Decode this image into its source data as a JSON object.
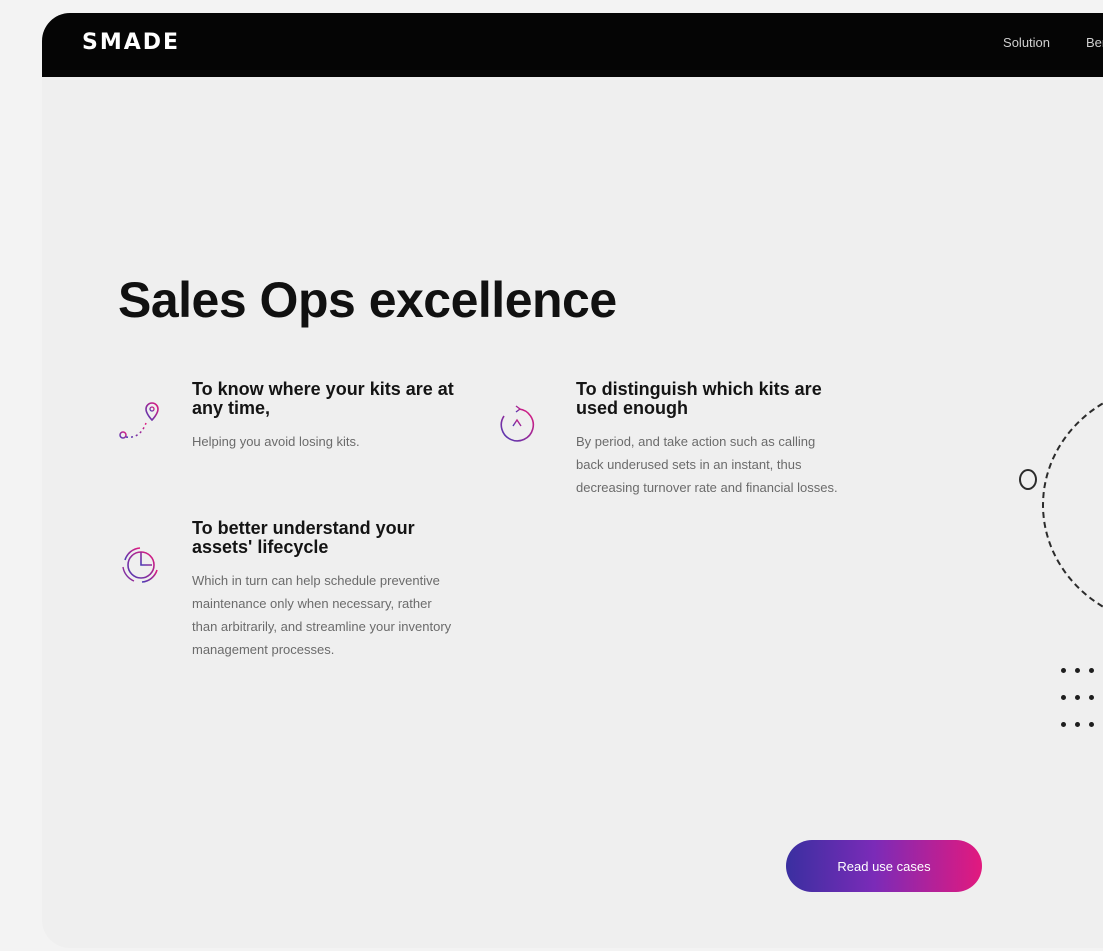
{
  "brand": {
    "logo_text": "SMADE"
  },
  "nav": {
    "items": [
      "Solution",
      "Benefits"
    ]
  },
  "hero": {
    "title": "Sales Ops excellence"
  },
  "features": [
    {
      "icon": "map-pin-route-icon",
      "title": "To know where your kits are at any time,",
      "text": "Helping you avoid losing kits."
    },
    {
      "icon": "lifecycle-cycle-icon",
      "title": "To better understand your assets' lifecycle",
      "text": "Which in turn can help schedule preventive maintenance only when necessary, rather than arbitrarily, and streamline your inventory management processes."
    },
    {
      "icon": "usage-gauge-icon",
      "title": "To distinguish which kits are used enough",
      "text": "By period, and take action such as calling back underused sets in an instant, thus decreasing turnover rate and financial losses."
    }
  ],
  "cta": {
    "label": "Read use cases"
  },
  "colors": {
    "accent_start": "#3a2fa0",
    "accent_end": "#e2197e",
    "topbar": "#050505"
  }
}
